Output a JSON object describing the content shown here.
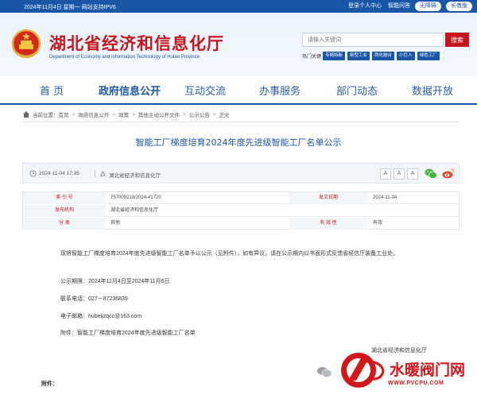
{
  "topbar": {
    "date": "2024年11月4日 星期一 网站支持IPV6",
    "login": "登录个人中心",
    "robot": "智能问答",
    "barrier_free": "无障碍",
    "elder": "长者版"
  },
  "header": {
    "title": "湖北省经济和信息化厅",
    "subtitle": "Department of Economy and Information Technology of Hubei Province",
    "search_placeholder": "请输入关键词",
    "search_button": "搜索",
    "hot_label": "热门关键",
    "hot_words": [
      "专精特新",
      "新型工业",
      "两化融合",
      "小巨人",
      "绿色工厂"
    ]
  },
  "nav": {
    "items": [
      "首 页",
      "政府信息公开",
      "互动交流",
      "办事服务",
      "部门动态",
      "数据开放"
    ]
  },
  "breadcrumb": {
    "label": "当前位置：",
    "items": [
      "首页",
      "政府信息公开",
      "政策",
      "其他主动公开文件",
      "公示公告",
      "正文"
    ]
  },
  "article": {
    "title": "智能工厂梯度培育2024年度先进级智能工厂名单公示",
    "time": "2024-11-04 17:35",
    "source": "湖北省经济和信息化厅",
    "font_buttons": [
      "A",
      "A",
      "A"
    ]
  },
  "meta": {
    "label_index": "索 引 号",
    "value_index": "757009218/2024-41720",
    "label_date": "发文日期",
    "value_date": "2024-11-04",
    "label_org": "发布机构",
    "value_org": "湖北省经济和信息化厅",
    "label_cat": "分 类",
    "value_cat": "其他",
    "label_valid": "有 效 性",
    "value_valid": "有效"
  },
  "body": {
    "para1": "现将智能工厂梯度培育2024年度先进级智能工厂名单予以公示（见附件），如有异议，请在公示期内以书面形式反馈省经信厅装备工业处。",
    "period": "公示期限：2024年11月4日至2024年11月6日",
    "phone": "联系电话：027－87236839",
    "email": "电子邮箱：hubeijzqcc@163.com",
    "attachment_line": "附件：智能工厂梯度培育2024年度先进级智能工厂名单",
    "signature": "湖北省经济和信息化厅",
    "attachments_label": "附件："
  },
  "watermark": {
    "brand": "水暖阀门网",
    "url": "WWW.PVCPU.COM"
  }
}
